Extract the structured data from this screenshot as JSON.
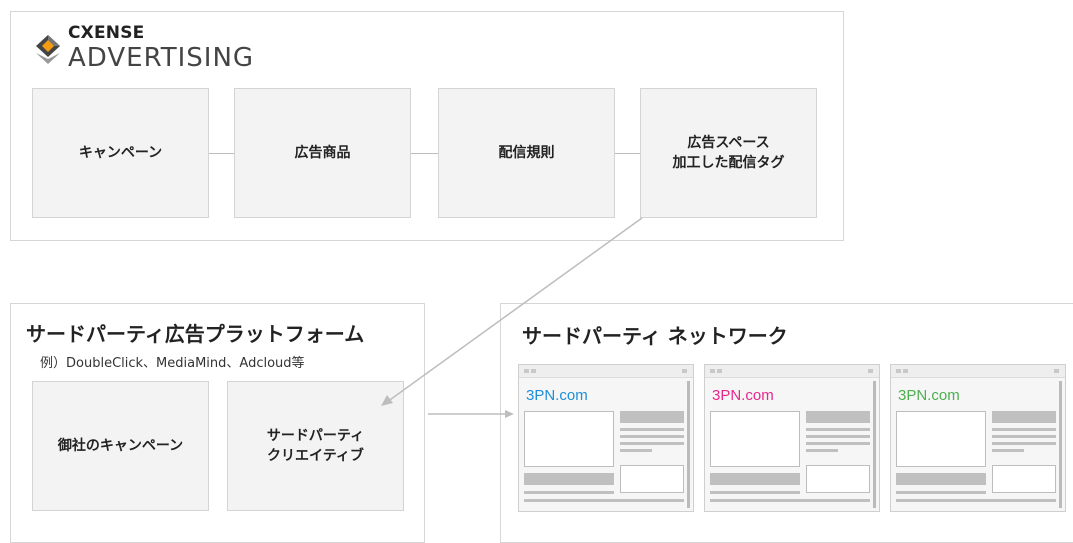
{
  "brand": {
    "line1": "CXENSE",
    "line2": "ADVERTISING"
  },
  "cxense_flow": [
    {
      "label": "キャンペーン"
    },
    {
      "label": "広告商品"
    },
    {
      "label": "配信規則"
    },
    {
      "label": "広告スペース\n加工した配信タグ"
    }
  ],
  "third_party_platform": {
    "title": "サードパーティ広告プラットフォーム",
    "subtitle": "例）DoubleClick、MediaMind、Adcloud等",
    "boxes": [
      {
        "label": "御社のキャンペーン"
      },
      {
        "label": "サードパーティ\nクリエイティブ"
      }
    ]
  },
  "third_party_network": {
    "title": "サードパーティ ネットワーク",
    "sites": [
      {
        "name": "3PN.com",
        "color": "#1e8fd6"
      },
      {
        "name": "3PN.com",
        "color": "#e6288c"
      },
      {
        "name": "3PN.com",
        "color": "#4caf50"
      }
    ]
  }
}
